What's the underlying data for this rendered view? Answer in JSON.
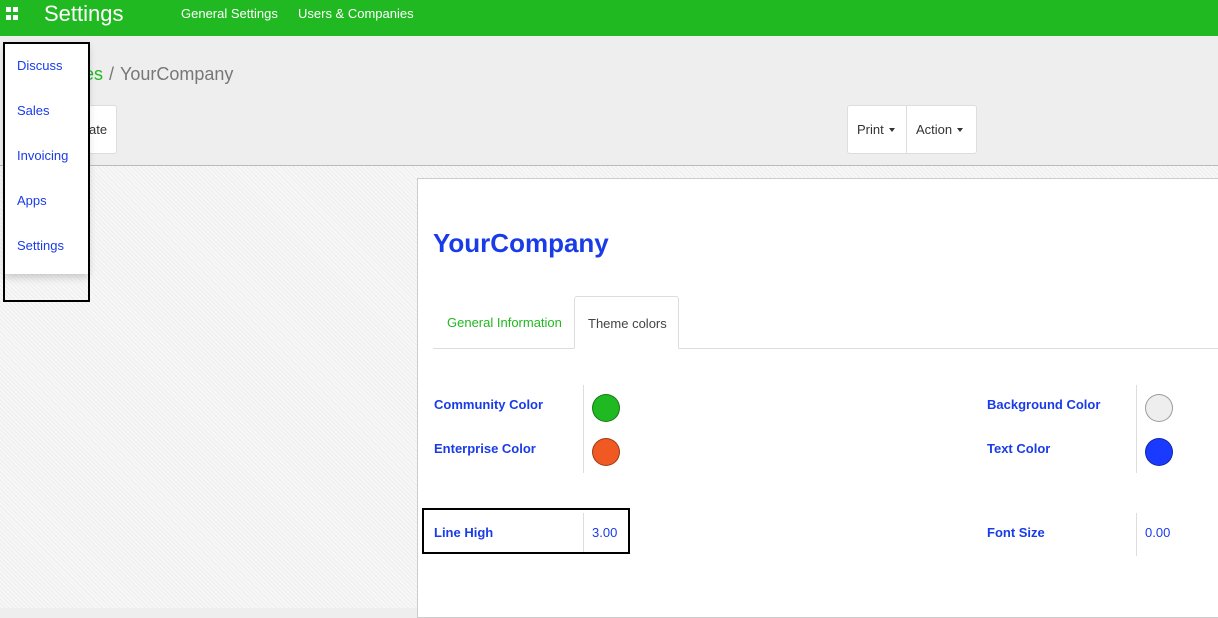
{
  "navbar": {
    "brand": "Settings",
    "links": [
      "General Settings",
      "Users & Companies"
    ]
  },
  "breadcrumb": {
    "parent": "es",
    "separator": "/",
    "current": "YourCompany"
  },
  "toolbar": {
    "create_label": "ate",
    "print_label": "Print",
    "action_label": "Action"
  },
  "apps_menu": {
    "items": [
      "Discuss",
      "Sales",
      "Invoicing",
      "Apps",
      "Settings"
    ]
  },
  "form": {
    "title": "YourCompany",
    "tabs": [
      "General Information",
      "Theme colors"
    ],
    "fields": {
      "community_color": {
        "label": "Community Color",
        "color": "#21b921"
      },
      "enterprise_color": {
        "label": "Enterprise Color",
        "color": "#f05a22"
      },
      "background_color": {
        "label": "Background Color",
        "color": "#eeeeee"
      },
      "text_color": {
        "label": "Text Color",
        "color": "#1a3bff"
      },
      "line_high": {
        "label": "Line High",
        "value": "3.00"
      },
      "font_size": {
        "label": "Font Size",
        "value": "0.00"
      }
    }
  },
  "colors": {
    "brand": "#21b921",
    "link": "#1a3be8"
  }
}
